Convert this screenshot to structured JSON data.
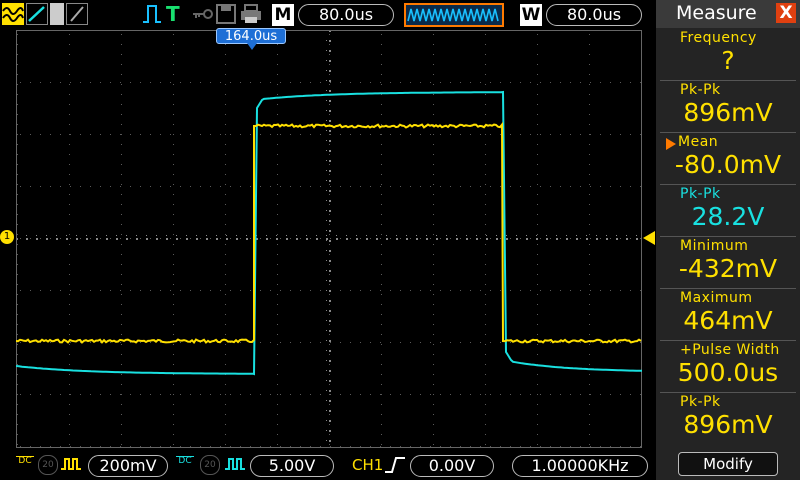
{
  "header": {
    "run_mode": "T",
    "timebase_box_label": "M",
    "timebase": "80.0us",
    "window_box_label": "W",
    "window_time": "80.0us"
  },
  "trigger_marker": "164.0us",
  "measure": {
    "title": "Measure",
    "close": "X",
    "items": [
      {
        "label": "Frequency",
        "value": "?",
        "label_color": "#ffe000",
        "value_color": "#ffe000"
      },
      {
        "label": "Pk-Pk",
        "value": "896mV",
        "label_color": "#ffe000",
        "value_color": "#ffe000"
      },
      {
        "label": "Mean",
        "value": "-80.0mV",
        "label_color": "#ffe000",
        "value_color": "#ffe000",
        "selected": true
      },
      {
        "label": "Pk-Pk",
        "value": "28.2V",
        "label_color": "#19e0e0",
        "value_color": "#19e0e0"
      },
      {
        "label": "Minimum",
        "value": "-432mV",
        "label_color": "#ffe000",
        "value_color": "#ffe000"
      },
      {
        "label": "Maximum",
        "value": "464mV",
        "label_color": "#ffe000",
        "value_color": "#ffe000"
      },
      {
        "label": "+Pulse Width",
        "value": "500.0us",
        "label_color": "#ffe000",
        "value_color": "#ffe000"
      },
      {
        "label": "Pk-Pk",
        "value": "896mV",
        "label_color": "#ffe000",
        "value_color": "#ffe000"
      }
    ],
    "modify_label": "Modify"
  },
  "footer": {
    "ch1_coupling": "DC",
    "ch1_bw": "20",
    "ch1_scale": "200mV",
    "ch2_coupling": "DC",
    "ch2_bw": "20",
    "ch2_scale": "5.00V",
    "trigger_source": "CH1",
    "trigger_level": "0.00V",
    "frequency": "1.00000KHz"
  },
  "colors": {
    "ch1": "#ffe000",
    "ch2": "#19e0e0",
    "marker": "#1e6fd6",
    "accent": "#ff7a00",
    "close": "#e04010"
  }
}
